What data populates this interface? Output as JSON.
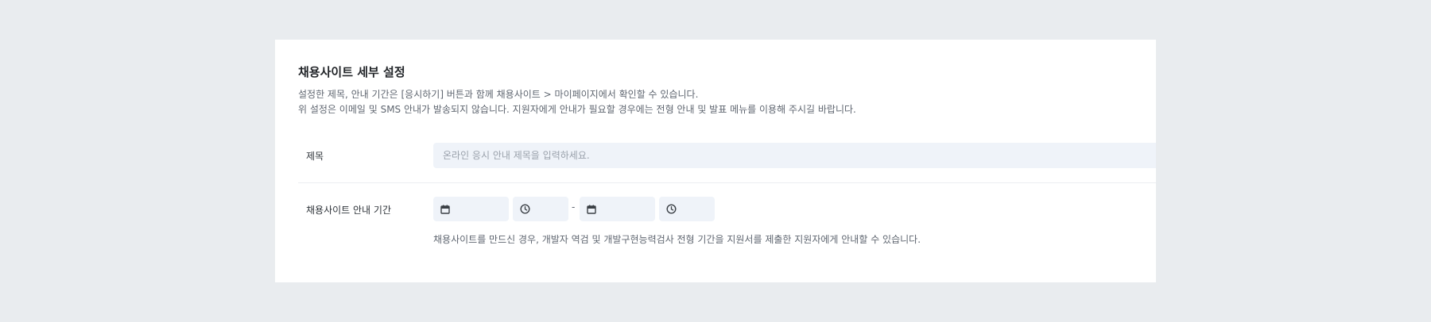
{
  "section": {
    "title": "채용사이트 세부 설정",
    "desc_line1": "설정한 제목, 안내 기간은 [응시하기] 버튼과 함께 채용사이트 > 마이페이지에서 확인할 수 있습니다.",
    "desc_line2": "위 설정은 이메일 및 SMS 안내가 발송되지 않습니다. 지원자에게 안내가 필요할 경우에는 전형 안내 및 발표 메뉴를 이용해 주시길 바랍니다."
  },
  "form": {
    "title_row": {
      "label": "제목",
      "value": "",
      "placeholder": "온라인 응시 안내 제목을 입력하세요."
    },
    "period_row": {
      "label": "채용사이트 안내 기간",
      "start_date": "",
      "start_time": "",
      "separator": "-",
      "end_date": "",
      "end_time": "",
      "hint": "채용사이트를 만드신 경우, 개발자 역검 및 개발구현능력검사 전형 기간을 지원서를 제출한 지원자에게 안내할 수 있습니다."
    }
  },
  "icons": {
    "date_picker": "calendar-icon",
    "time_picker": "clock-icon"
  },
  "colors": {
    "page_background": "#e9ecef",
    "card_background": "#ffffff",
    "input_background": "#eff3f9",
    "title_text": "#222529",
    "body_text": "#5f6670"
  }
}
